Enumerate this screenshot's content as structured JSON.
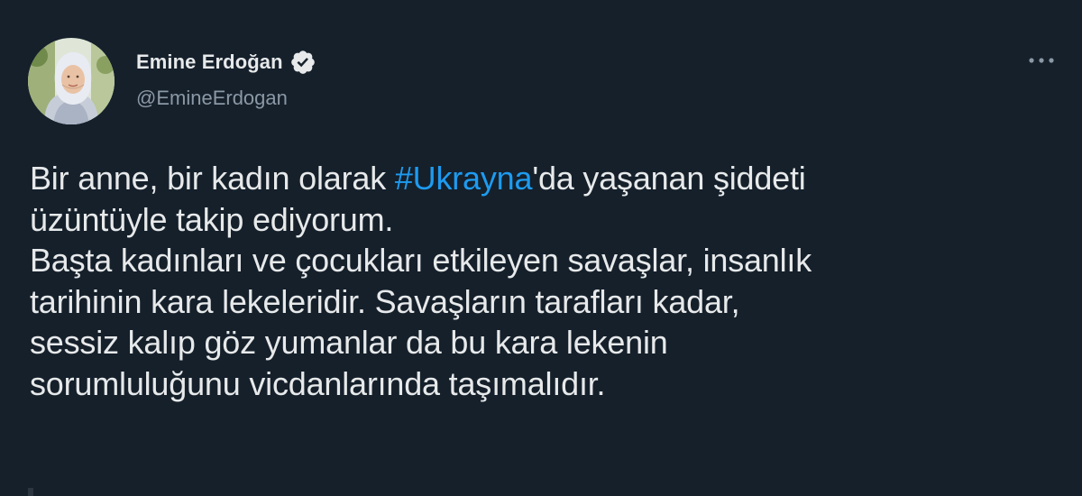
{
  "user": {
    "display_name": "Emine Erdoğan",
    "handle": "@EmineErdogan",
    "verified": true
  },
  "icons": {
    "verified": "verified-badge-icon",
    "more": "more-horizontal-icon"
  },
  "tweet": {
    "line1_before": "Bir anne, bir kadın olarak ",
    "hashtag": "#Ukrayna",
    "line1_after": "'da yaşanan şiddeti",
    "line2": "üzüntüyle takip ediyorum.",
    "line3": "Başta kadınları ve çocukları etkileyen savaşlar, insanlık",
    "line4": "tarihinin kara lekeleridir. Savaşların tarafları kadar,",
    "line5": "sessiz kalıp göz yumanlar da bu kara lekenin",
    "line6": "sorumluluğunu vicdanlarında taşımalıdır."
  },
  "colors": {
    "background": "#15202b",
    "text": "#e7e9ea",
    "secondary": "#8b98a5",
    "accent": "#1d9bf0"
  }
}
